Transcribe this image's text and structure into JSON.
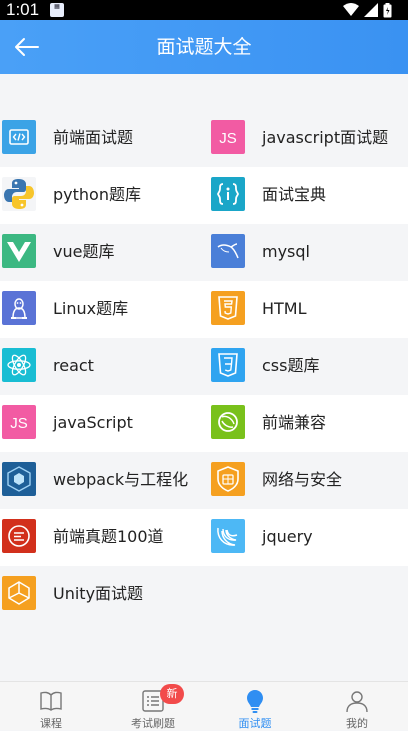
{
  "status": {
    "time": "1:01",
    "sim_label": "SIM"
  },
  "header": {
    "title": "面试题大全"
  },
  "rows": [
    [
      {
        "label": "前端面试题",
        "icon": "code-icon",
        "color": "#3ba3e6"
      },
      {
        "label": "javascript面试题",
        "icon": "js-icon",
        "color": "#f25ba3"
      }
    ],
    [
      {
        "label": "python题库",
        "icon": "python-icon",
        "color": "#ffffff"
      },
      {
        "label": "面试宝典",
        "icon": "braces-icon",
        "color": "#1aa6c8"
      }
    ],
    [
      {
        "label": "vue题库",
        "icon": "vue-icon",
        "color": "#3cb882"
      },
      {
        "label": "mysql",
        "icon": "mysql-icon",
        "color": "#4a7fd8"
      }
    ],
    [
      {
        "label": "Linux题库",
        "icon": "linux-icon",
        "color": "#5a73d6"
      },
      {
        "label": "HTML",
        "icon": "html5-icon",
        "color": "#f5a020"
      }
    ],
    [
      {
        "label": "react",
        "icon": "react-icon",
        "color": "#19bdd3"
      },
      {
        "label": "css题库",
        "icon": "css3-icon",
        "color": "#2fa4f0"
      }
    ],
    [
      {
        "label": "javaScript",
        "icon": "js-icon",
        "color": "#f25ba3"
      },
      {
        "label": "前端兼容",
        "icon": "compat-icon",
        "color": "#79c11b"
      }
    ],
    [
      {
        "label": "webpack与工程化",
        "icon": "webpack-icon",
        "color": "#1e5f98"
      },
      {
        "label": "网络与安全",
        "icon": "security-icon",
        "color": "#f5a020"
      }
    ],
    [
      {
        "label": "前端真题100道",
        "icon": "exam-icon",
        "color": "#d2301c"
      },
      {
        "label": "jquery",
        "icon": "jquery-icon",
        "color": "#4db8f5"
      }
    ],
    [
      {
        "label": "Unity面试题",
        "icon": "unity-icon",
        "color": "#f5a020"
      }
    ]
  ],
  "tabbar": {
    "items": [
      {
        "label": "课程",
        "icon": "book-icon"
      },
      {
        "label": "考试刷题",
        "icon": "list-icon",
        "badge": "新"
      },
      {
        "label": "面试题",
        "icon": "bulb-icon",
        "active": true
      },
      {
        "label": "我的",
        "icon": "user-icon"
      }
    ]
  }
}
